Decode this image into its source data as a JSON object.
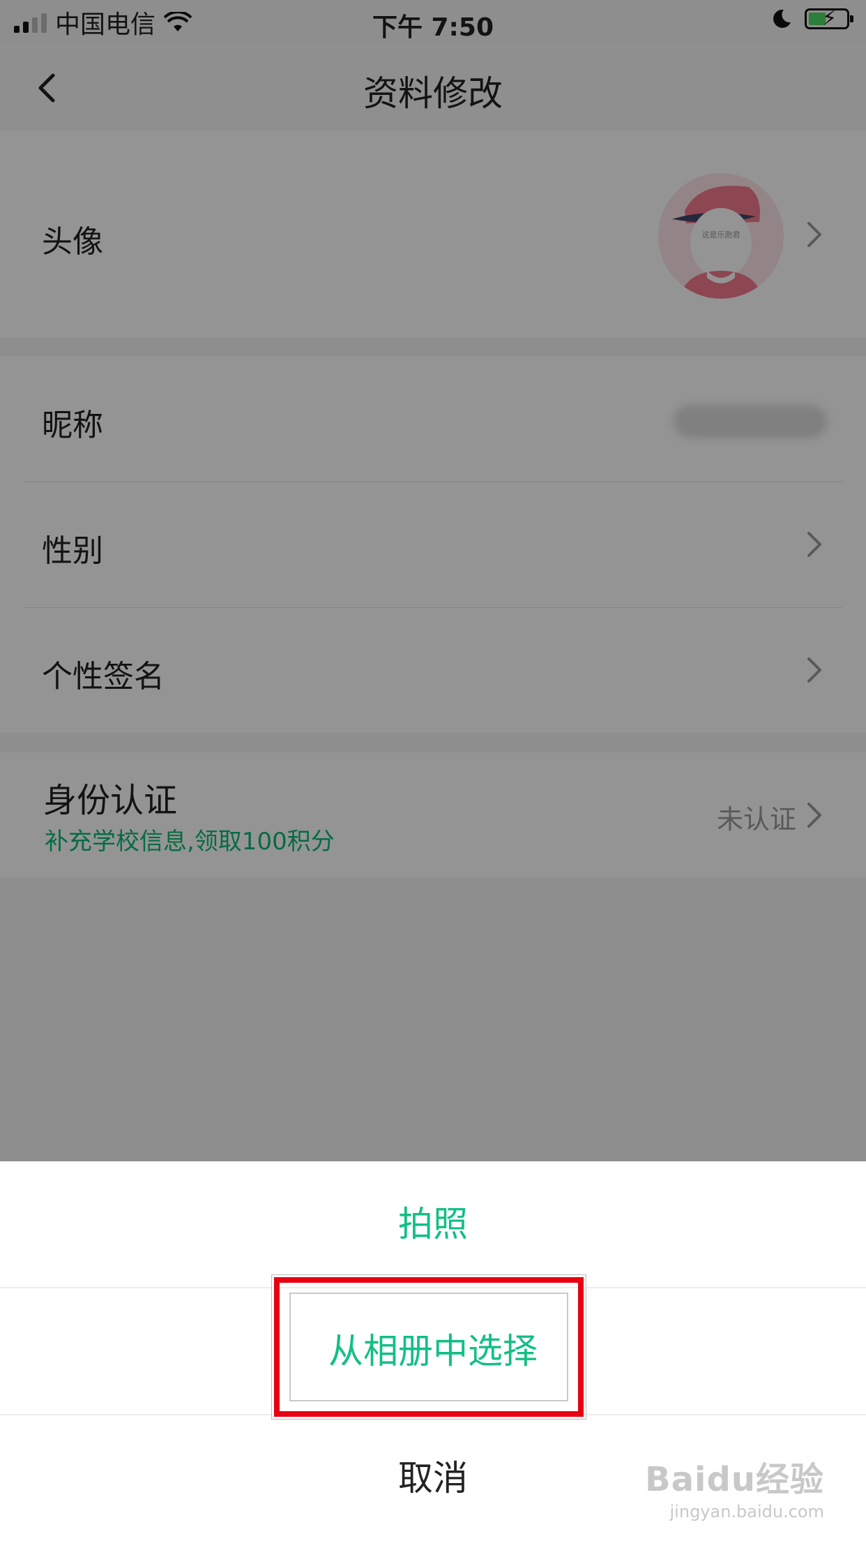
{
  "status_bar": {
    "carrier": "中国电信",
    "time": "下午 7:50",
    "icons": [
      "signal-icon",
      "wifi-icon",
      "moon-icon",
      "battery-charging-icon"
    ]
  },
  "nav": {
    "title": "资料修改",
    "back_icon": "chevron-left-icon"
  },
  "rows": {
    "avatar_label": "头像",
    "avatar_caption": "这是乐跑君",
    "nickname_label": "昵称",
    "gender_label": "性别",
    "signature_label": "个性签名",
    "identity_label": "身份认证",
    "identity_hint": "补充学校信息,领取100积分",
    "identity_status": "未认证"
  },
  "action_sheet": {
    "take_photo": "拍照",
    "choose_from_album": "从相册中选择",
    "cancel": "取消"
  },
  "watermark": {
    "brand": "Baidu经验",
    "url": "jingyan.baidu.com"
  },
  "colors": {
    "accent_green": "#13bf84",
    "hint_green": "#0bb873",
    "highlight_red": "#e60012"
  }
}
